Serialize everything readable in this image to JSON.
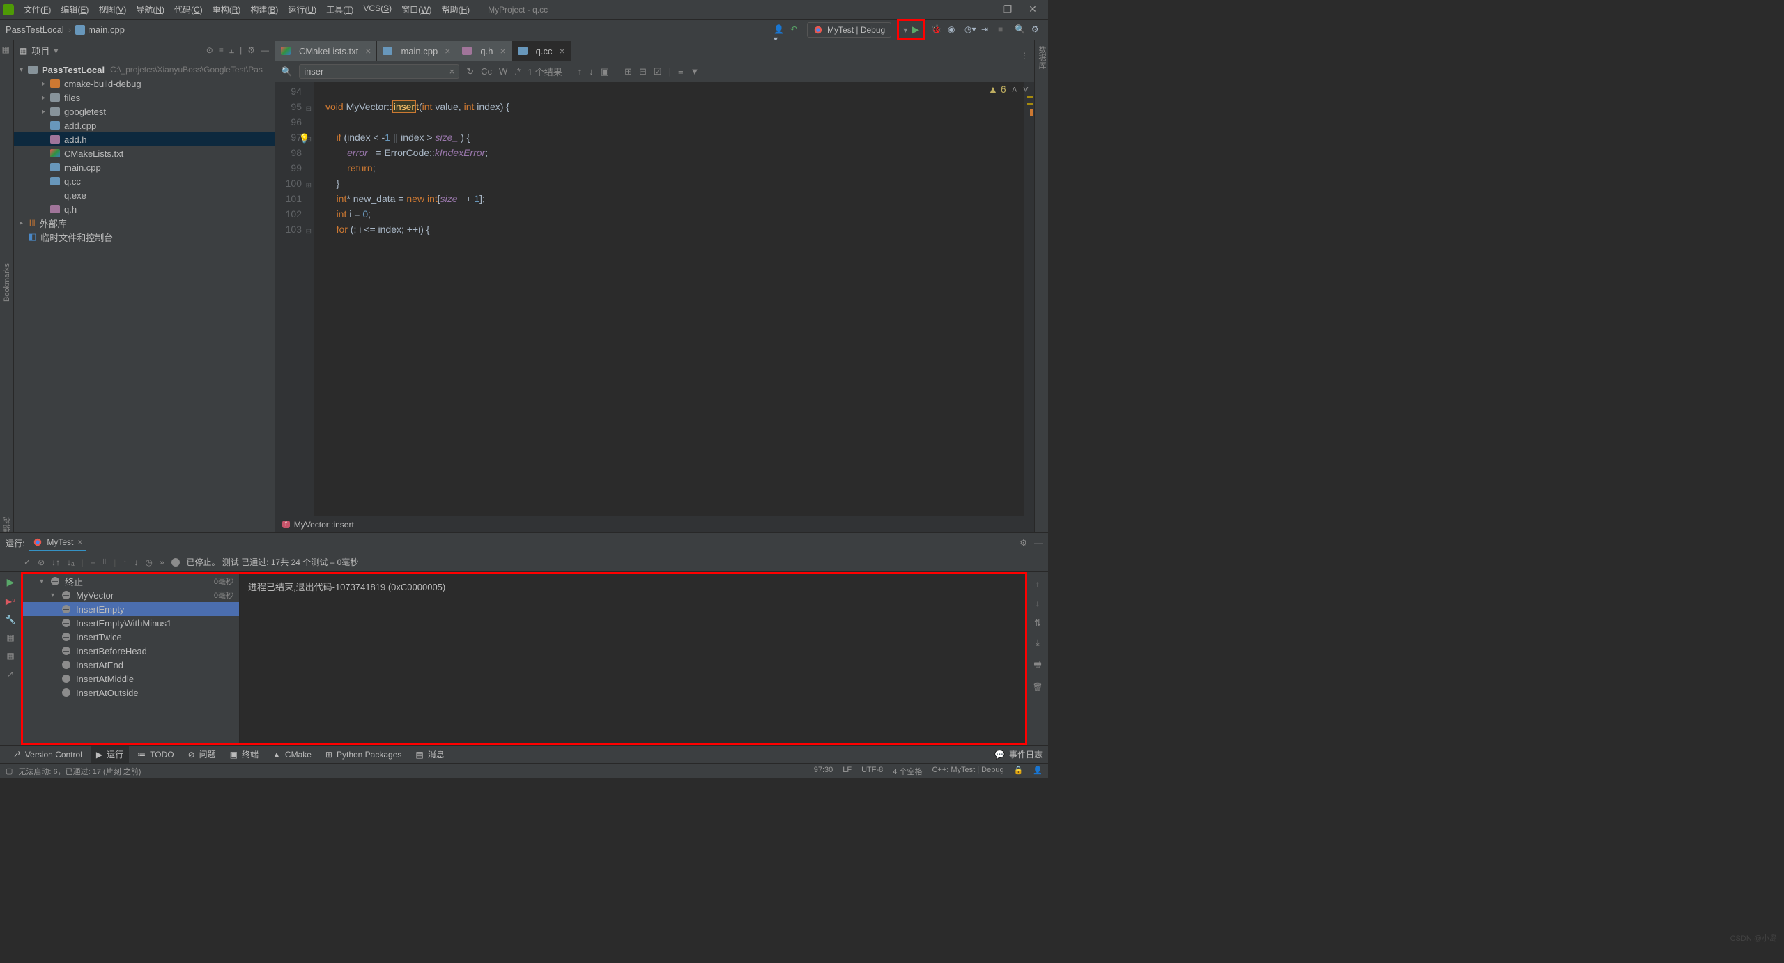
{
  "window": {
    "title": "MyProject - q.cc"
  },
  "menu": [
    {
      "label": "文件",
      "key": "F"
    },
    {
      "label": "编辑",
      "key": "E"
    },
    {
      "label": "视图",
      "key": "V"
    },
    {
      "label": "导航",
      "key": "N"
    },
    {
      "label": "代码",
      "key": "C"
    },
    {
      "label": "重构",
      "key": "R"
    },
    {
      "label": "构建",
      "key": "B"
    },
    {
      "label": "运行",
      "key": "U"
    },
    {
      "label": "工具",
      "key": "T"
    },
    {
      "label": "VCS",
      "key": "S"
    },
    {
      "label": "窗口",
      "key": "W"
    },
    {
      "label": "帮助",
      "key": "H"
    }
  ],
  "breadcrumb": {
    "root": "PassTestLocal",
    "file": "main.cpp"
  },
  "run_config": {
    "label": "MyTest | Debug"
  },
  "sidebar": {
    "title": "项目",
    "root": {
      "name": "PassTestLocal",
      "path": "C:\\_projetcs\\XianyuBoss\\GoogleTest\\Pas"
    },
    "items": [
      {
        "name": "cmake-build-debug",
        "type": "folder-orange",
        "indent": 2,
        "arrow": "▸"
      },
      {
        "name": "files",
        "type": "folder",
        "indent": 2,
        "arrow": "▸"
      },
      {
        "name": "googletest",
        "type": "folder",
        "indent": 2,
        "arrow": "▸"
      },
      {
        "name": "add.cpp",
        "type": "cpp",
        "indent": 2
      },
      {
        "name": "add.h",
        "type": "h",
        "indent": 2,
        "selected": true
      },
      {
        "name": "CMakeLists.txt",
        "type": "cmake",
        "indent": 2
      },
      {
        "name": "main.cpp",
        "type": "cpp",
        "indent": 2
      },
      {
        "name": "q.cc",
        "type": "cpp",
        "indent": 2
      },
      {
        "name": "q.exe",
        "type": "exe",
        "indent": 2
      },
      {
        "name": "q.h",
        "type": "h",
        "indent": 2
      }
    ],
    "external_libs": "外部库",
    "scratch": "临时文件和控制台"
  },
  "editor": {
    "tabs": [
      {
        "label": "CMakeLists.txt",
        "icon": "cmake"
      },
      {
        "label": "main.cpp",
        "icon": "cpp"
      },
      {
        "label": "q.h",
        "icon": "h"
      },
      {
        "label": "q.cc",
        "icon": "cpp",
        "active": true
      }
    ],
    "find": {
      "query": "inser",
      "results": "1 个结果"
    },
    "warnings": "6",
    "lines_start": 94,
    "lines": [
      {
        "n": 94,
        "code": ""
      },
      {
        "n": 95,
        "code": "void MyVector::insert(int value, int index) {",
        "fold": "⊟"
      },
      {
        "n": 96,
        "code": ""
      },
      {
        "n": 97,
        "code": "    if (index < -1 || index > size_ ) {",
        "bulb": true,
        "fold": "⊟"
      },
      {
        "n": 98,
        "code": "        error_ = ErrorCode::kIndexError;"
      },
      {
        "n": 99,
        "code": "        return;"
      },
      {
        "n": 100,
        "code": "    }",
        "fold": "⊞"
      },
      {
        "n": 101,
        "code": "    int* new_data = new int[size_ + 1];"
      },
      {
        "n": 102,
        "code": "    int i = 0;"
      },
      {
        "n": 103,
        "code": "    for (; i <= index; ++i) {",
        "fold": "⊟"
      }
    ],
    "breadcrumb_bottom": {
      "class": "MyVector",
      "fn": "insert"
    }
  },
  "run_panel": {
    "tab_prefix": "运行:",
    "tab_name": "MyTest",
    "status": "已停止。 测试 已通过: 17共 24 个测试 – 0毫秒",
    "console": "进程已结束,退出代码-1073741819 (0xC0000005)",
    "tree": [
      {
        "label": "终止",
        "indent": 1,
        "time": "0毫秒",
        "arrow": "▾"
      },
      {
        "label": "MyVector",
        "indent": 2,
        "time": "0毫秒",
        "arrow": "▾"
      },
      {
        "label": "InsertEmpty",
        "indent": 3,
        "selected": true
      },
      {
        "label": "InsertEmptyWithMinus1",
        "indent": 3
      },
      {
        "label": "InsertTwice",
        "indent": 3
      },
      {
        "label": "InsertBeforeHead",
        "indent": 3
      },
      {
        "label": "InsertAtEnd",
        "indent": 3
      },
      {
        "label": "InsertAtMiddle",
        "indent": 3
      },
      {
        "label": "InsertAtOutside",
        "indent": 3
      }
    ]
  },
  "bottom_tabs": [
    {
      "label": "Version Control",
      "icon": "branch"
    },
    {
      "label": "运行",
      "icon": "play",
      "active": true
    },
    {
      "label": "TODO",
      "icon": "list"
    },
    {
      "label": "问题",
      "icon": "warn"
    },
    {
      "label": "终端",
      "icon": "terminal"
    },
    {
      "label": "CMake",
      "icon": "cmake"
    },
    {
      "label": "Python Packages",
      "icon": "pkg"
    },
    {
      "label": "消息",
      "icon": "msg"
    }
  ],
  "bottom_right": "事件日志",
  "status": {
    "left": "无法启动: 6，已通过: 17 (片刻 之前)",
    "right": {
      "pos": "97:30",
      "le": "LF",
      "enc": "UTF-8",
      "indent": "4 个空格",
      "context": "C++: MyTest | Debug"
    }
  },
  "left_stripe": {
    "bookmarks": "Bookmarks",
    "structure": "结构"
  },
  "right_stripe": "数据库",
  "watermark": "CSDN @小岛"
}
